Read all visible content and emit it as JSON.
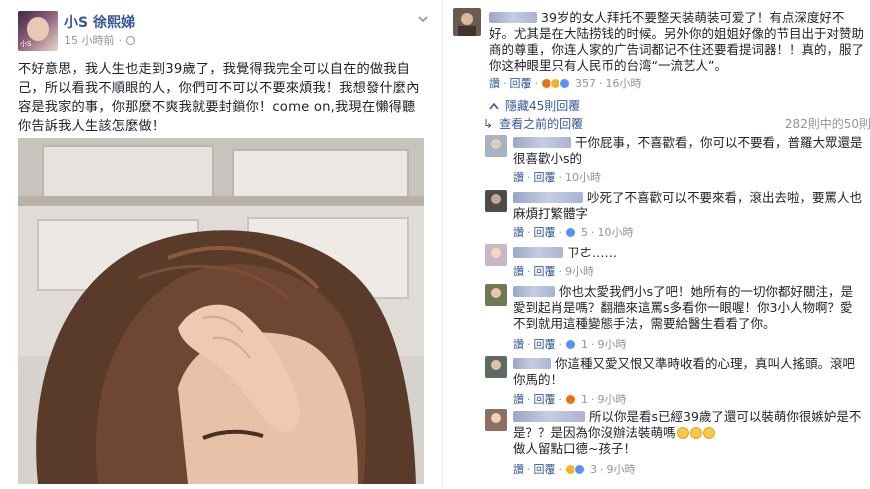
{
  "post": {
    "author": "小S 徐熙娣",
    "time": "15 小時前",
    "avatar_label": "小S",
    "text": "不好意思，我人生也走到39歲了，我覺得我完全可以自在的做我自己，所以看我不順眼的人，你們可不可以不要來煩我！我想發什麼內容是我家的事，你那麼不爽我就要封鎖你！come on,我現在懶得聽你告訴我人生該怎麼做！",
    "icons": [
      "globe-icon",
      "chevron-down-icon"
    ]
  },
  "top_comment": {
    "text": "39岁的女人拜托不要整天装萌装可爱了！有点深度好不好。尤其是在大陆捞钱的时候。另外你的姐姐好像的节目出于对赞助商的尊重，你连人家的广告词都记不住还要看提词器！！真的，服了你这种眼里只有人民币的台湾“一流艺人”。",
    "like": "讚",
    "reply": "回覆",
    "reactions": [
      "angry",
      "haha",
      "like"
    ],
    "count": "357",
    "time": "16小時"
  },
  "hidden_replies": "隱藏45則回覆",
  "previous_replies": "查看之前的回覆",
  "pager": "282則中的50則",
  "replies": [
    {
      "text": "干你屁事，不喜歡看，你可以不要看，普羅大眾還是很喜歡小s的",
      "like": "讚",
      "reply": "回覆",
      "count": "",
      "time": "10小時",
      "reactions": []
    },
    {
      "text": "吵死了不喜歡可以不要來看，滾出去啦，要罵人也麻煩打繁體字",
      "like": "讚",
      "reply": "回覆",
      "count": "5",
      "time": "10小時",
      "reactions": [
        "like"
      ]
    },
    {
      "text": "ㄗㄜ……",
      "like": "讚",
      "reply": "回覆",
      "count": "",
      "time": "9小時",
      "reactions": []
    },
    {
      "text": "你也太愛我們小s了吧！她所有的一切你都好關注，是愛到起肖是嗎？翻牆來這罵s多看你一眼喔！你3小人物啊？愛不到就用這種變態手法，需要給醫生看看了你。",
      "like": "讚",
      "reply": "回覆",
      "count": "1",
      "time": "9小時",
      "reactions": [
        "like"
      ]
    },
    {
      "text": "你這種又愛又恨又準時收看的心理，真叫人搖頭。滾吧你馬的！",
      "like": "讚",
      "reply": "回覆",
      "count": "1",
      "time": "9小時",
      "reactions": [
        "angry"
      ]
    },
    {
      "text": "所以你是看s已經39歲了還可以裝萌你很嫉妒是不是？？是因為你沒辦法裝萌嗎",
      "text2": "做人留點口德~孩子！",
      "like": "讚",
      "reply": "回覆",
      "count": "3",
      "time": "9小時",
      "reactions": [
        "haha",
        "like"
      ]
    }
  ],
  "colors": {
    "link": "#365899",
    "meta": "#90949c",
    "text": "#1d2129",
    "like": "#5890ff",
    "haha": "#f7b125",
    "angry": "#e9710f"
  }
}
